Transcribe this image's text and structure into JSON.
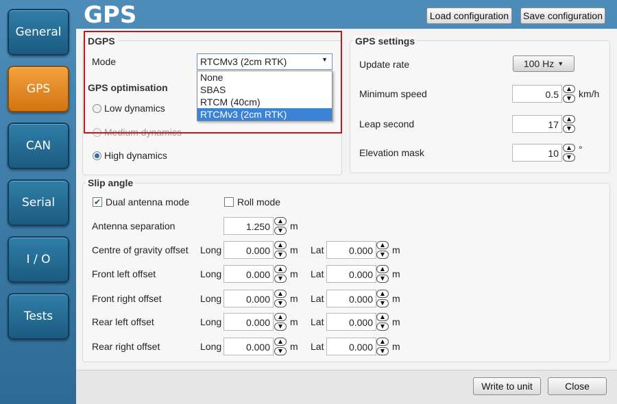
{
  "sidebar": {
    "items": [
      {
        "label": "General"
      },
      {
        "label": "GPS"
      },
      {
        "label": "CAN"
      },
      {
        "label": "Serial"
      },
      {
        "label": "I / O"
      },
      {
        "label": "Tests"
      }
    ]
  },
  "header": {
    "title": "GPS",
    "load_label": "Load configuration",
    "save_label": "Save configuration"
  },
  "dgps": {
    "title": "DGPS",
    "mode_label": "Mode",
    "mode_value": "RTCMv3 (2cm RTK)",
    "options": [
      "None",
      "SBAS",
      "RTCM (40cm)",
      "RTCMv3 (2cm RTK)"
    ]
  },
  "gps_opt": {
    "title": "GPS optimisation",
    "low": "Low dynamics",
    "medium": "Medium dynamics",
    "high": "High dynamics"
  },
  "gps_settings": {
    "title": "GPS settings",
    "update_rate_label": "Update rate",
    "update_rate_value": "100 Hz",
    "min_speed_label": "Minimum speed",
    "min_speed_value": "0.5",
    "min_speed_unit": "km/h",
    "leap_label": "Leap second",
    "leap_value": "17",
    "elev_label": "Elevation mask",
    "elev_value": "10",
    "elev_unit": "°"
  },
  "slip": {
    "title": "Slip angle",
    "dual_label": "Dual antenna mode",
    "roll_label": "Roll mode",
    "ant_sep_label": "Antenna separation",
    "ant_sep_value": "1.250",
    "unit_m": "m",
    "long": "Long",
    "lat": "Lat",
    "rows": [
      {
        "label": "Centre of gravity offset",
        "long": "0.000",
        "lat": "0.000"
      },
      {
        "label": "Front left offset",
        "long": "0.000",
        "lat": "0.000"
      },
      {
        "label": "Front right offset",
        "long": "0.000",
        "lat": "0.000"
      },
      {
        "label": "Rear left offset",
        "long": "0.000",
        "lat": "0.000"
      },
      {
        "label": "Rear right offset",
        "long": "0.000",
        "lat": "0.000"
      }
    ]
  },
  "footer": {
    "write_label": "Write to unit",
    "close_label": "Close"
  }
}
